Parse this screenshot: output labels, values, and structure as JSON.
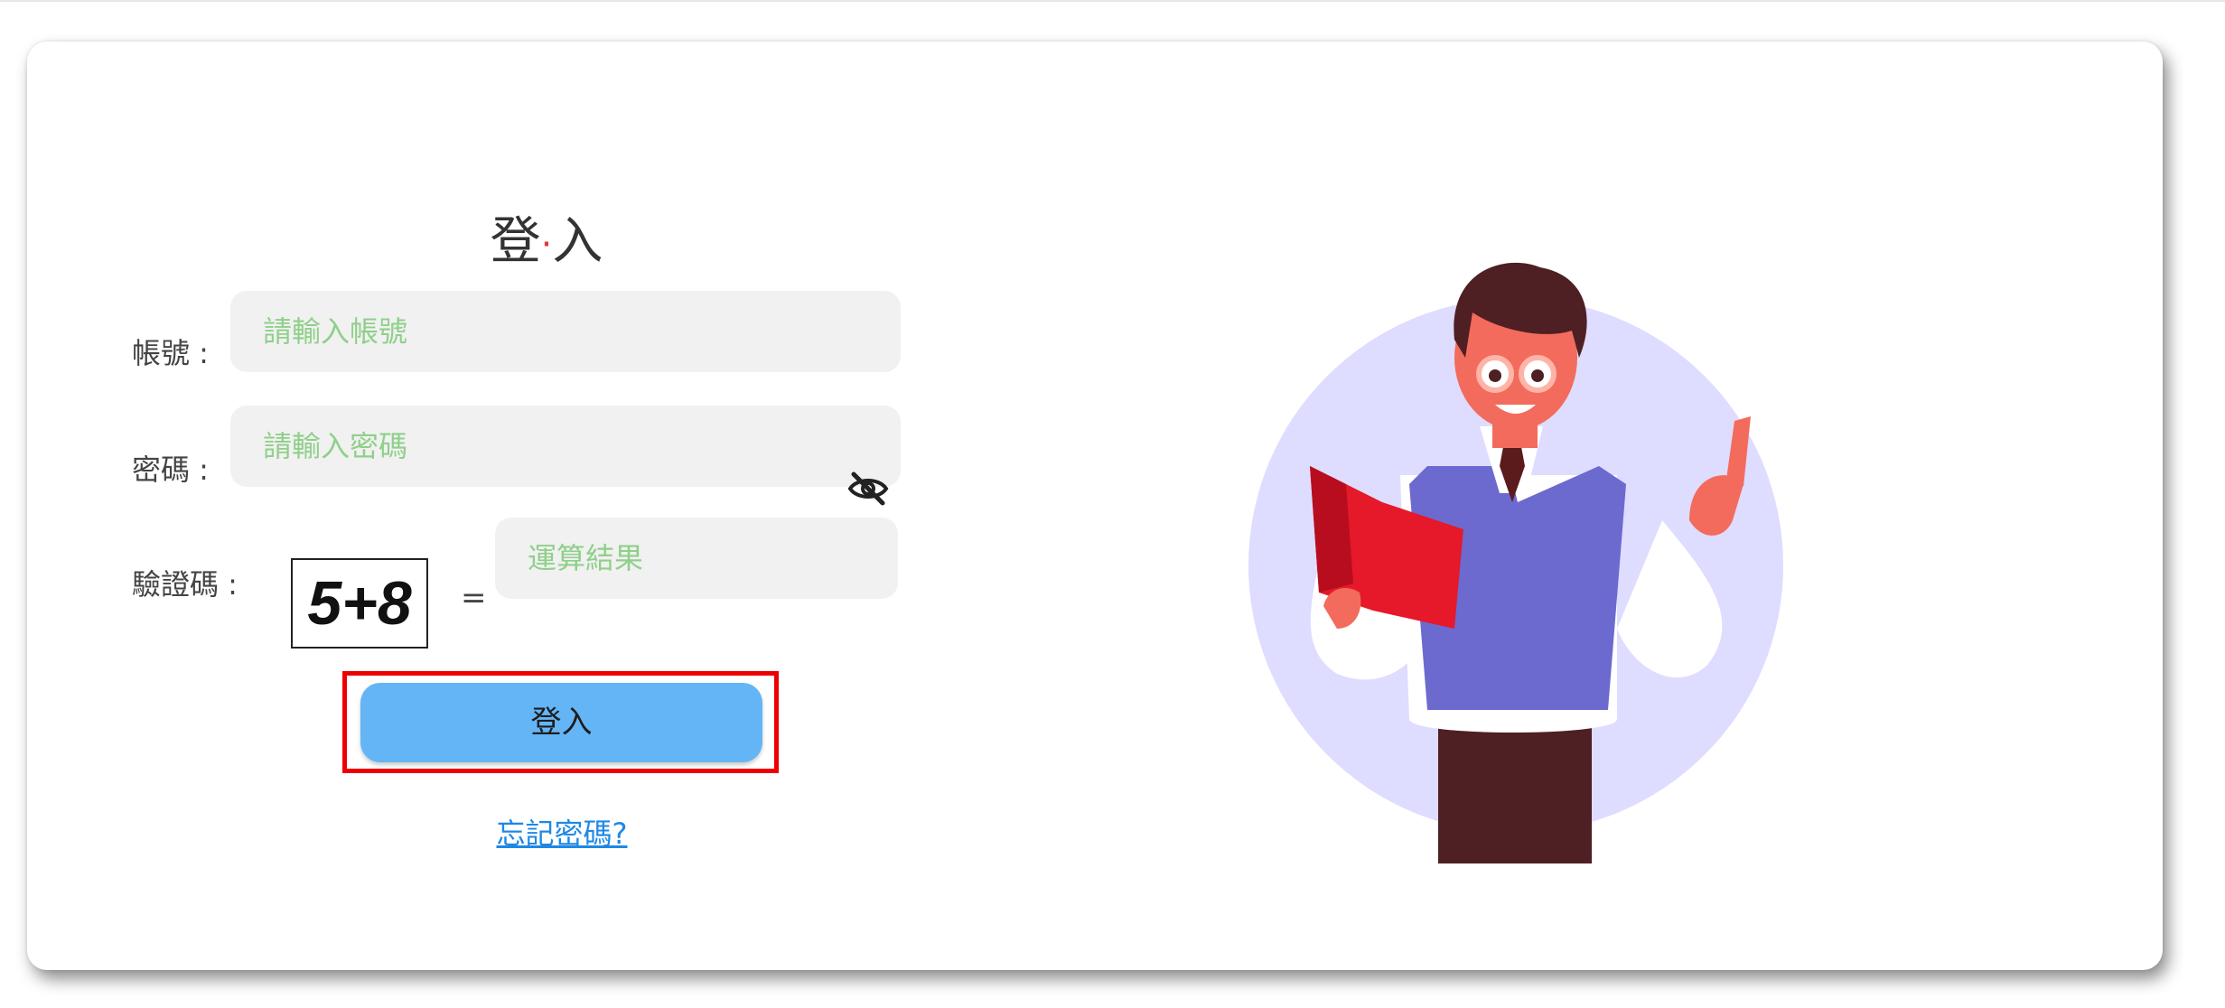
{
  "login_form": {
    "title_left": "登",
    "title_dot": "·",
    "title_right": "入",
    "account_label": "帳號 :",
    "account_placeholder": "請輸入帳號",
    "password_label": "密碼 :",
    "password_placeholder": "請輸入密碼",
    "captcha_label": "驗證碼 :",
    "captcha_text": "5+8",
    "equals": "=",
    "captcha_placeholder": "運算結果",
    "login_button": "登入",
    "forgot_password": "忘記密碼?"
  },
  "icons": {
    "password_toggle": "eye-slash-icon"
  },
  "colors": {
    "button": "#64b5f6",
    "placeholder": "#8fd08a",
    "link": "#1e88e5",
    "highlight": "#ee0000",
    "illustration_circle": "#dedcff",
    "vest": "#6c6acf"
  }
}
